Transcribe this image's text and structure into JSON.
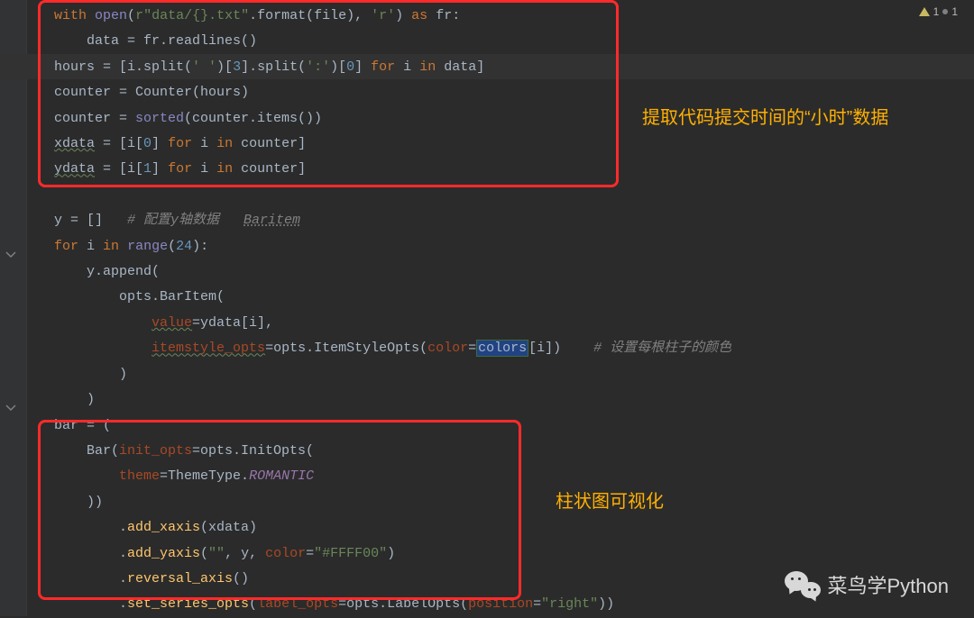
{
  "editor": {
    "warnings_count": "1",
    "hints_count": "1"
  },
  "code_lines": {
    "l1": "with open(r\"data/{}.txt\".format(file), 'r') as fr:",
    "l2": "    data = fr.readlines()",
    "l3": "hours = [i.split(' ')[3].split(':')[0] for i in data]",
    "l4": "counter = Counter(hours)",
    "l5": "counter = sorted(counter.items())",
    "l6": "xdata = [i[0] for i in counter]",
    "l7": "ydata = [i[1] for i in counter]",
    "l8": "",
    "l9a": "y = []",
    "l9c": "# 配置y轴数据",
    "l9h": "Baritem",
    "l10": "for i in range(24):",
    "l11": "    y.append(",
    "l12": "        opts.BarItem(",
    "l13": "            value=ydata[i],",
    "l14a": "            itemstyle_opts=opts.ItemStyleOpts(color=colors[i])",
    "l14c": "# 设置每根柱子的颜色",
    "l15": "        )",
    "l16": "    )",
    "l17": "bar = (",
    "l18": "    Bar(init_opts=opts.InitOpts(",
    "l19": "        theme=ThemeType.ROMANTIC",
    "l20": "    ))",
    "l21": "        .add_xaxis(xdata)",
    "l22": "        .add_yaxis(\"\", y, color=\"#FFFF00\")",
    "l23": "        .reversal_axis()",
    "l24": "        .set_series_opts(label_opts=opts.LabelOpts(position=\"right\"))"
  },
  "annotations": {
    "a1": "提取代码提交时间的“小时”数据",
    "a2": "柱状图可视化"
  },
  "watermark": "菜鸟学Python"
}
